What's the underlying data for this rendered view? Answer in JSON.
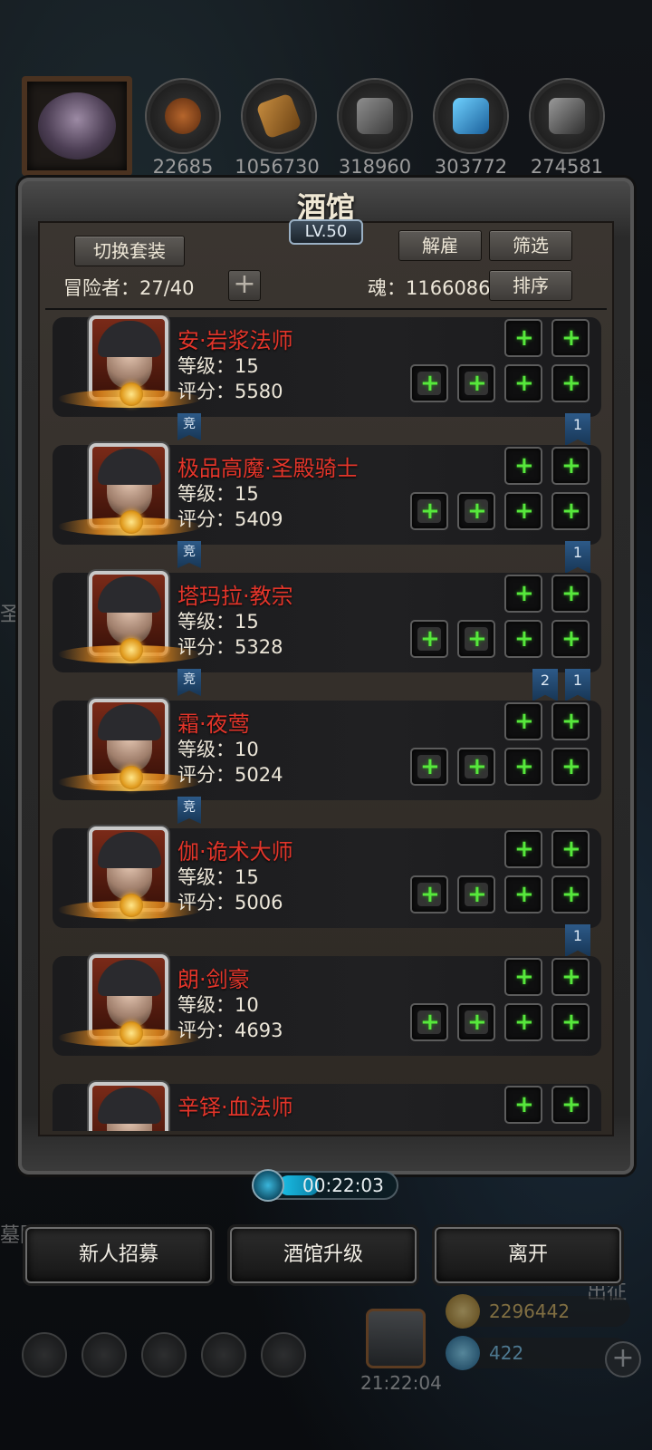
{
  "resources": [
    "22685",
    "1056730",
    "318960",
    "303772",
    "274581"
  ],
  "panel": {
    "title": "酒馆",
    "level": "LV.50",
    "switch_outfit": "切换套装",
    "dismiss": "解雇",
    "filter": "筛选",
    "sort": "排序",
    "adventurers_label": "冒险者：27/40",
    "soul_label": "魂：1166086",
    "add_symbol": "+"
  },
  "heroes": [
    {
      "name": "安·岩浆法师",
      "level": "等级：15",
      "score": "评分：5580",
      "comp": "竞",
      "ranks": [
        "1"
      ]
    },
    {
      "name": "极品高魔·圣殿骑士",
      "level": "等级：15",
      "score": "评分：5409",
      "comp": "竞",
      "ranks": [
        "1"
      ]
    },
    {
      "name": "塔玛拉·教宗",
      "level": "等级：15",
      "score": "评分：5328",
      "comp": "竞",
      "ranks": [
        "2",
        "1"
      ]
    },
    {
      "name": "霜·夜莺",
      "level": "等级：10",
      "score": "评分：5024",
      "comp": "竞",
      "ranks": []
    },
    {
      "name": "伽·诡术大师",
      "level": "等级：15",
      "score": "评分：5006",
      "comp": "",
      "ranks": [
        "1"
      ]
    },
    {
      "name": "朗·剑豪",
      "level": "等级：10",
      "score": "评分：4693",
      "comp": "",
      "ranks": []
    },
    {
      "name": "辛铎·血法师",
      "level": "",
      "score": "",
      "comp": "",
      "ranks": []
    }
  ],
  "timer": "00:22:03",
  "timer_progress": 0.28,
  "actions": {
    "recruit": "新人招募",
    "upgrade": "酒馆升级",
    "leave": "离开"
  },
  "hud": {
    "gold": "2296442",
    "gems": "422",
    "time": "21:22:04",
    "expedition": "出征",
    "left_partial_1": "墓园",
    "left_partial_2": "圣"
  },
  "colors": {
    "name_red": "#e3352a",
    "green_plus": "#57e83c",
    "badge_blue": "#2d5a88"
  }
}
